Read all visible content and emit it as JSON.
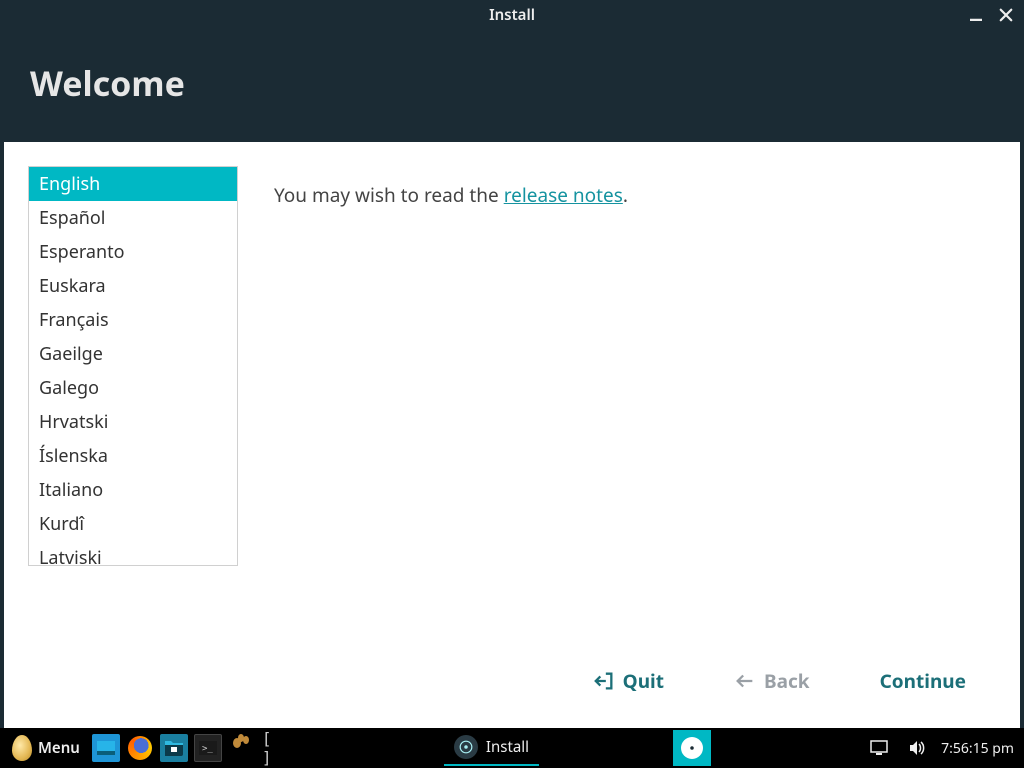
{
  "window": {
    "title": "Install",
    "heading": "Welcome"
  },
  "info": {
    "prefix": "You may wish to read the ",
    "link_text": "release notes",
    "suffix": "."
  },
  "languages": [
    "English",
    "Español",
    "Esperanto",
    "Euskara",
    "Français",
    "Gaeilge",
    "Galego",
    "Hrvatski",
    "Íslenska",
    "Italiano",
    "Kurdî",
    "Latviski"
  ],
  "selected_language_index": 0,
  "footer": {
    "quit": "Quit",
    "back": "Back",
    "continue": "Continue"
  },
  "taskbar": {
    "menu_label": "Menu",
    "workspace_label": "[ ]",
    "task_label": "Install",
    "clock": "7:56:15 pm"
  }
}
